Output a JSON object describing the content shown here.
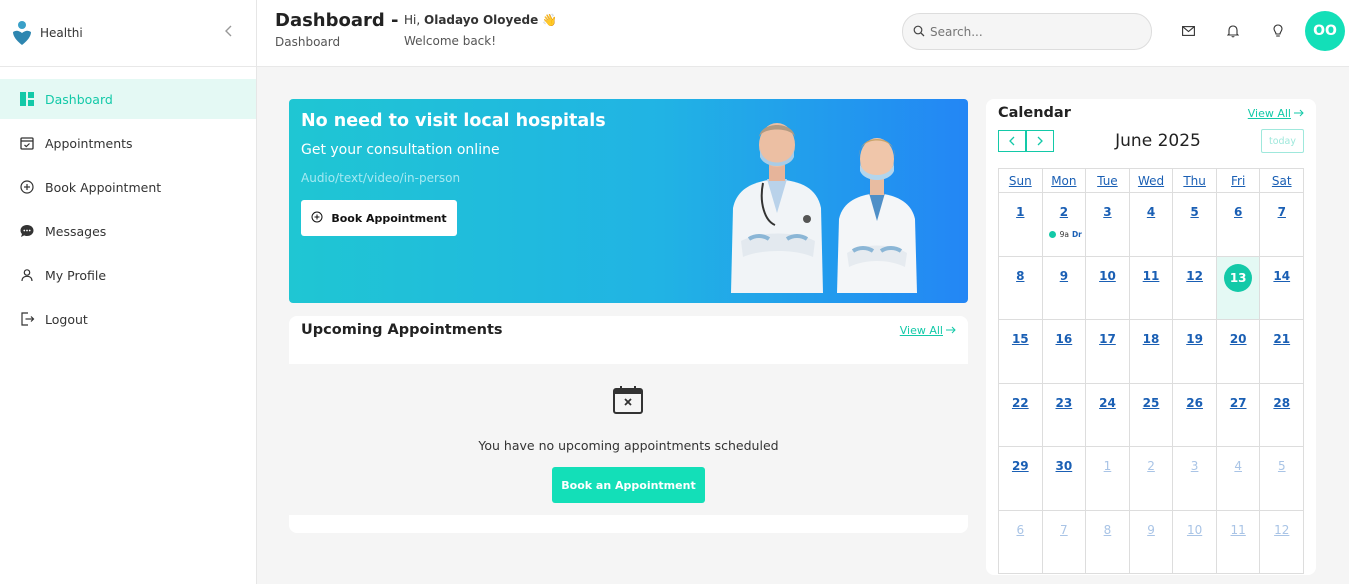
{
  "brand": {
    "name": "Healthi"
  },
  "sidebar": {
    "items": [
      {
        "label": "Dashboard",
        "icon": "dashboard-icon",
        "active": true
      },
      {
        "label": "Appointments",
        "icon": "calendar-check-icon"
      },
      {
        "label": "Book Appointment",
        "icon": "plus-circle-icon"
      },
      {
        "label": "Messages",
        "icon": "chat-icon"
      },
      {
        "label": "My Profile",
        "icon": "user-icon"
      },
      {
        "label": "Logout",
        "icon": "logout-icon"
      }
    ]
  },
  "header": {
    "title": "Dashboard -",
    "breadcrumb": "Dashboard",
    "greeting_prefix": "Hi, ",
    "user_name": "Oladayo Oloyede",
    "greeting_emoji": "👋",
    "welcome": "Welcome back!",
    "search_placeholder": "Search...",
    "avatar_initials": "OO"
  },
  "hero": {
    "title": "No need to visit local hospitals",
    "subtitle": "Get your consultation online",
    "modes": "Audio/text/video/in-person",
    "button_label": "Book Appointment"
  },
  "upcoming": {
    "title": "Upcoming Appointments",
    "view_all": "View All",
    "empty_text": "You have no upcoming appointments scheduled",
    "button_label": "Book an Appointment"
  },
  "calendar": {
    "title": "Calendar",
    "view_all": "View All",
    "month_label": "June 2025",
    "today_label": "today",
    "weekdays": [
      "Sun",
      "Mon",
      "Tue",
      "Wed",
      "Thu",
      "Fri",
      "Sat"
    ],
    "weeks": [
      [
        {
          "d": "1"
        },
        {
          "d": "2",
          "event_time": "9a",
          "event_title": "Dr"
        },
        {
          "d": "3"
        },
        {
          "d": "4"
        },
        {
          "d": "5"
        },
        {
          "d": "6"
        },
        {
          "d": "7"
        }
      ],
      [
        {
          "d": "8"
        },
        {
          "d": "9"
        },
        {
          "d": "10"
        },
        {
          "d": "11"
        },
        {
          "d": "12"
        },
        {
          "d": "13",
          "today": true
        },
        {
          "d": "14"
        }
      ],
      [
        {
          "d": "15"
        },
        {
          "d": "16"
        },
        {
          "d": "17"
        },
        {
          "d": "18"
        },
        {
          "d": "19"
        },
        {
          "d": "20"
        },
        {
          "d": "21"
        }
      ],
      [
        {
          "d": "22"
        },
        {
          "d": "23"
        },
        {
          "d": "24"
        },
        {
          "d": "25"
        },
        {
          "d": "26"
        },
        {
          "d": "27"
        },
        {
          "d": "28"
        }
      ],
      [
        {
          "d": "29"
        },
        {
          "d": "30"
        },
        {
          "d": "1",
          "other": true
        },
        {
          "d": "2",
          "other": true
        },
        {
          "d": "3",
          "other": true
        },
        {
          "d": "4",
          "other": true
        },
        {
          "d": "5",
          "other": true
        }
      ],
      [
        {
          "d": "6",
          "other": true
        },
        {
          "d": "7",
          "other": true
        },
        {
          "d": "8",
          "other": true
        },
        {
          "d": "9",
          "other": true
        },
        {
          "d": "10",
          "other": true
        },
        {
          "d": "11",
          "other": true
        },
        {
          "d": "12",
          "other": true
        }
      ]
    ]
  },
  "colors": {
    "accent": "#13dfb8",
    "link": "#1a5fb4",
    "hero_start": "#1fc6d3",
    "hero_end": "#2386f5"
  }
}
